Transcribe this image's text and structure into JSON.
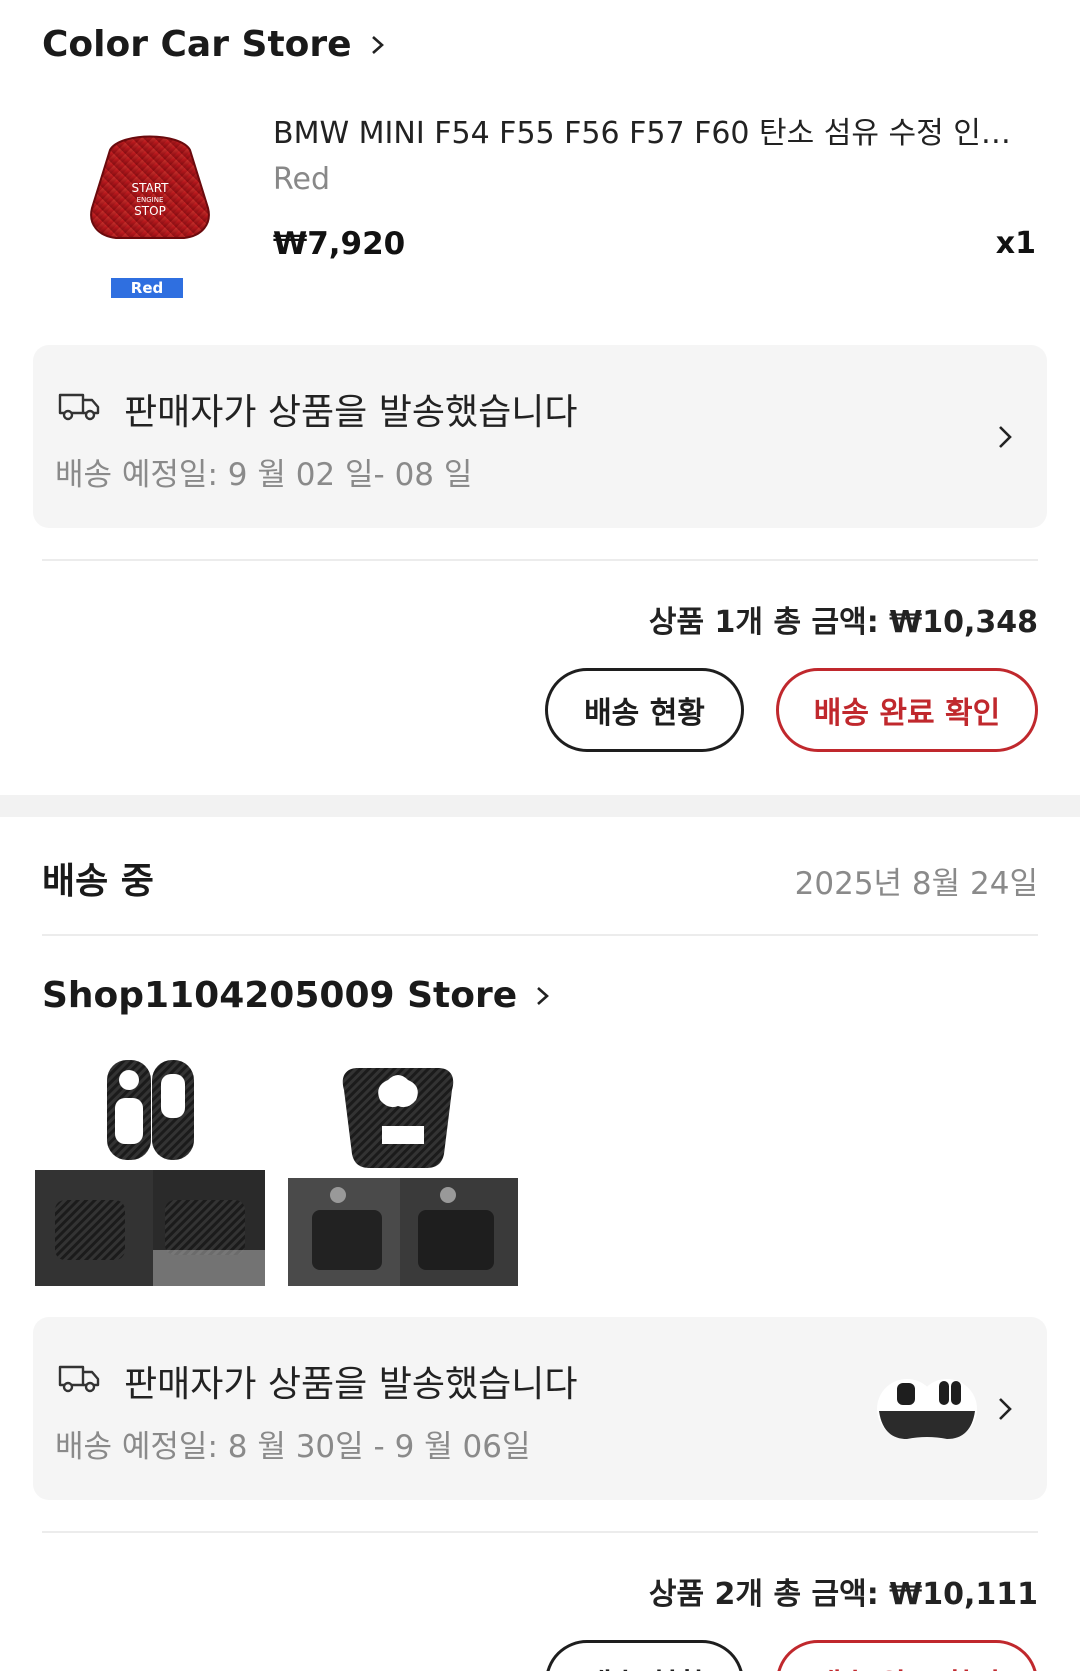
{
  "store1": {
    "name": "Color Car Store",
    "product": {
      "title": "BMW MINI F54 F55 F56 F57 F60 탄소 섬유 수정 인테...",
      "variant": "Red",
      "price": "₩7,920",
      "qty": "x1",
      "thumb_badge": "Red",
      "thumb_text": [
        "START",
        "ENGINE",
        "STOP"
      ]
    },
    "shipping": {
      "status": "판매자가 상품을 발송했습니다",
      "eta": "배송 예정일: 9 월 02 일- 08 일"
    },
    "total": "상품 1개 총 금액: ₩10,348",
    "buttons": {
      "track": "배송 현황",
      "confirm": "배송 완료 확인"
    }
  },
  "order2": {
    "status": "배송 중",
    "date": "2025년 8월 24일"
  },
  "store2": {
    "name": "Shop1104205009 Store",
    "shipping": {
      "status": "판매자가 상품을 발송했습니다",
      "eta": "배송 예정일: 8 월 30일 - 9 월 06일"
    },
    "total": "상품 2개 총 금액: ₩10,111",
    "buttons": {
      "track": "배송 현황",
      "confirm": "배송 완료 확인"
    }
  },
  "icons": {
    "chevron": "chevron-right-icon",
    "truck": "truck-icon"
  },
  "colors": {
    "accent_red": "#c0282d",
    "badge_blue": "#2f6fe0",
    "card_bg": "#f5f5f5",
    "muted_text": "#8a8a8a"
  }
}
